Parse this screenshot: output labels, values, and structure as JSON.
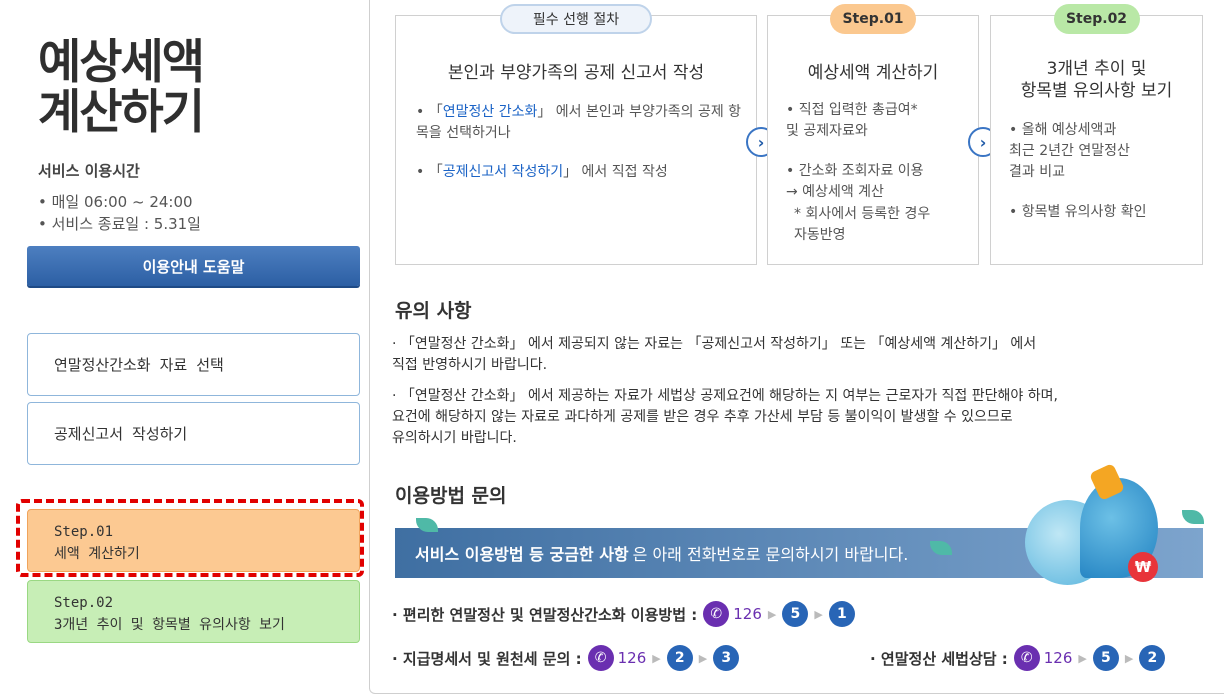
{
  "sidebar": {
    "title_line1": "예상세액",
    "title_line2": "계산하기",
    "service_hours_title": "서비스 이용시간",
    "hours": [
      "• 매일 06:00 ~ 24:00",
      "• 서비스 종료일 : 5.31일"
    ],
    "help_button": "이용안내 도움말",
    "nav": [
      "연말정산간소화 자료 선택",
      "공제신고서 작성하기"
    ],
    "steps": [
      {
        "label": "Step.01",
        "text": "세액 계산하기"
      },
      {
        "label": "Step.02",
        "text": "3개년 추이 및 항목별 유의사항 보기"
      }
    ]
  },
  "cards": [
    {
      "tag": "필수 선행 절차",
      "title": "본인과 부양가족의 공제 신고서 작성",
      "bullet1_pre": "• 「",
      "bullet1_link": "연말정산 간소화",
      "bullet1_post": "」 에서 본인과 부양가족의 공제 항목을 선택하거나",
      "bullet2_pre": "• 「",
      "bullet2_link": "공제신고서 작성하기",
      "bullet2_post": "」 에서 직접 작성"
    },
    {
      "tag": "Step.01",
      "title": "예상세액 계산하기",
      "text1": "• 직접 입력한 총급여*\n  및 공제자료와",
      "text2": "• 간소화 조회자료 이용\n  → 예상세액 계산",
      "text3": "* 회사에서 등록한 경우\n  자동반영"
    },
    {
      "tag": "Step.02",
      "title": "3개년 추이 및\n항목별 유의사항 보기",
      "text1": "• 올해 예상세액과\n  최근 2년간 연말정산\n  결과 비교",
      "text2": "• 항목별 유의사항 확인"
    }
  ],
  "notices": {
    "title": "유의 사항",
    "items": [
      "· 「연말정산 간소화」 에서 제공되지 않는 자료는 「공제신고서 작성하기」 또는 「예상세액 계산하기」 에서\n  직접 반영하시기 바랍니다.",
      "· 「연말정산 간소화」 에서 제공하는 자료가 세법상 공제요건에 해당하는 지 여부는 근로자가 직접 판단해야 하며,\n  요건에 해당하지 않는 자료로 과다하게 공제를 받은 경우 추후 가산세 부담 등 불이익이 발생할 수 있으므로\n  유의하시기 바랍니다."
    ]
  },
  "contact": {
    "title": "이용방법 문의",
    "banner_bold": "서비스 이용방법 등 궁금한 사항",
    "banner_rest": "은 아래 전화번호로 문의하시기 바랍니다.",
    "won_symbol": "₩",
    "lines": [
      {
        "label": "· 편리한 연말정산 및 연말정산간소화 이용방법 :",
        "number": "126",
        "steps": [
          "5",
          "1"
        ]
      },
      {
        "label": "· 지급명세서  및 원천세 문의 :",
        "number": "126",
        "steps": [
          "2",
          "3"
        ]
      },
      {
        "label": "· 연말정산  세법상담  :",
        "number": "126",
        "steps": [
          "5",
          "2"
        ]
      }
    ]
  },
  "colors": {
    "accent_blue": "#2c5fa4",
    "step1_orange": "#fcc992",
    "step2_green": "#c7eeb6",
    "highlight_red": "#e10000",
    "phone_purple": "#6a2fb0"
  }
}
